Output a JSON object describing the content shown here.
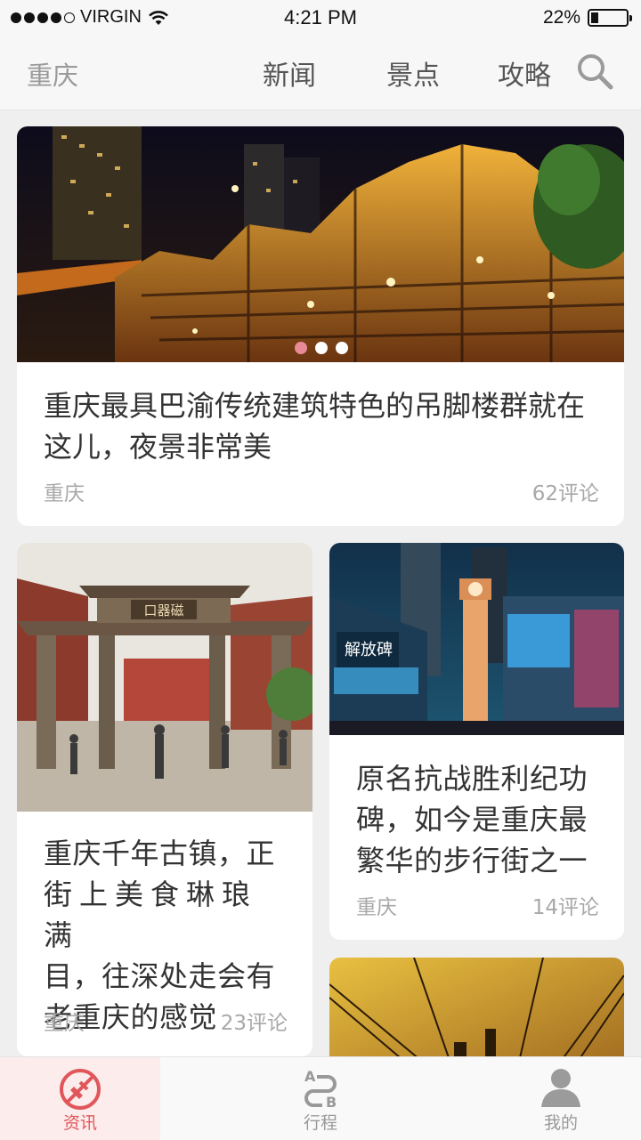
{
  "status": {
    "carrier": "VIRGIN",
    "time": "4:21 PM",
    "battery_text": "22%",
    "battery_level": 0.22,
    "signal_bars": 4
  },
  "header": {
    "city": "重庆",
    "tabs": [
      {
        "label": "新闻",
        "active": true
      },
      {
        "label": "景点",
        "active": false
      },
      {
        "label": "攻略",
        "active": false
      }
    ],
    "search_icon": "search-icon"
  },
  "feature": {
    "title": "重庆最具巴渝传统建筑特色的吊脚楼群就在这儿，夜景非常美",
    "tag": "重庆",
    "comments": "62评论",
    "slide_count": 3,
    "active_slide": 1
  },
  "cards": [
    {
      "title_line1": "重庆千年古镇，正",
      "title_line2": "街上美食琳琅满",
      "title_line3": "目，往深处走会有",
      "title_line4": "老重庆的感觉",
      "tag": "重庆",
      "comments": "23评论"
    },
    {
      "title_line1": "原名抗战胜利纪功",
      "title_line2": "碑，如今是重庆最",
      "title_line3": "繁华的步行街之一",
      "tag": "重庆",
      "comments": "14评论"
    }
  ],
  "photo_text": {
    "gate_sign": "口器磁",
    "tower_sign": "解放碑"
  },
  "tabbar": [
    {
      "label": "资讯",
      "icon": "news-icon",
      "active": true
    },
    {
      "label": "行程",
      "icon": "route-icon",
      "active": false,
      "icon_letters": [
        "A",
        "B"
      ]
    },
    {
      "label": "我的",
      "icon": "profile-icon",
      "active": false
    }
  ],
  "colors": {
    "accent": "#e06a77",
    "tab_active": "#e0565b"
  }
}
